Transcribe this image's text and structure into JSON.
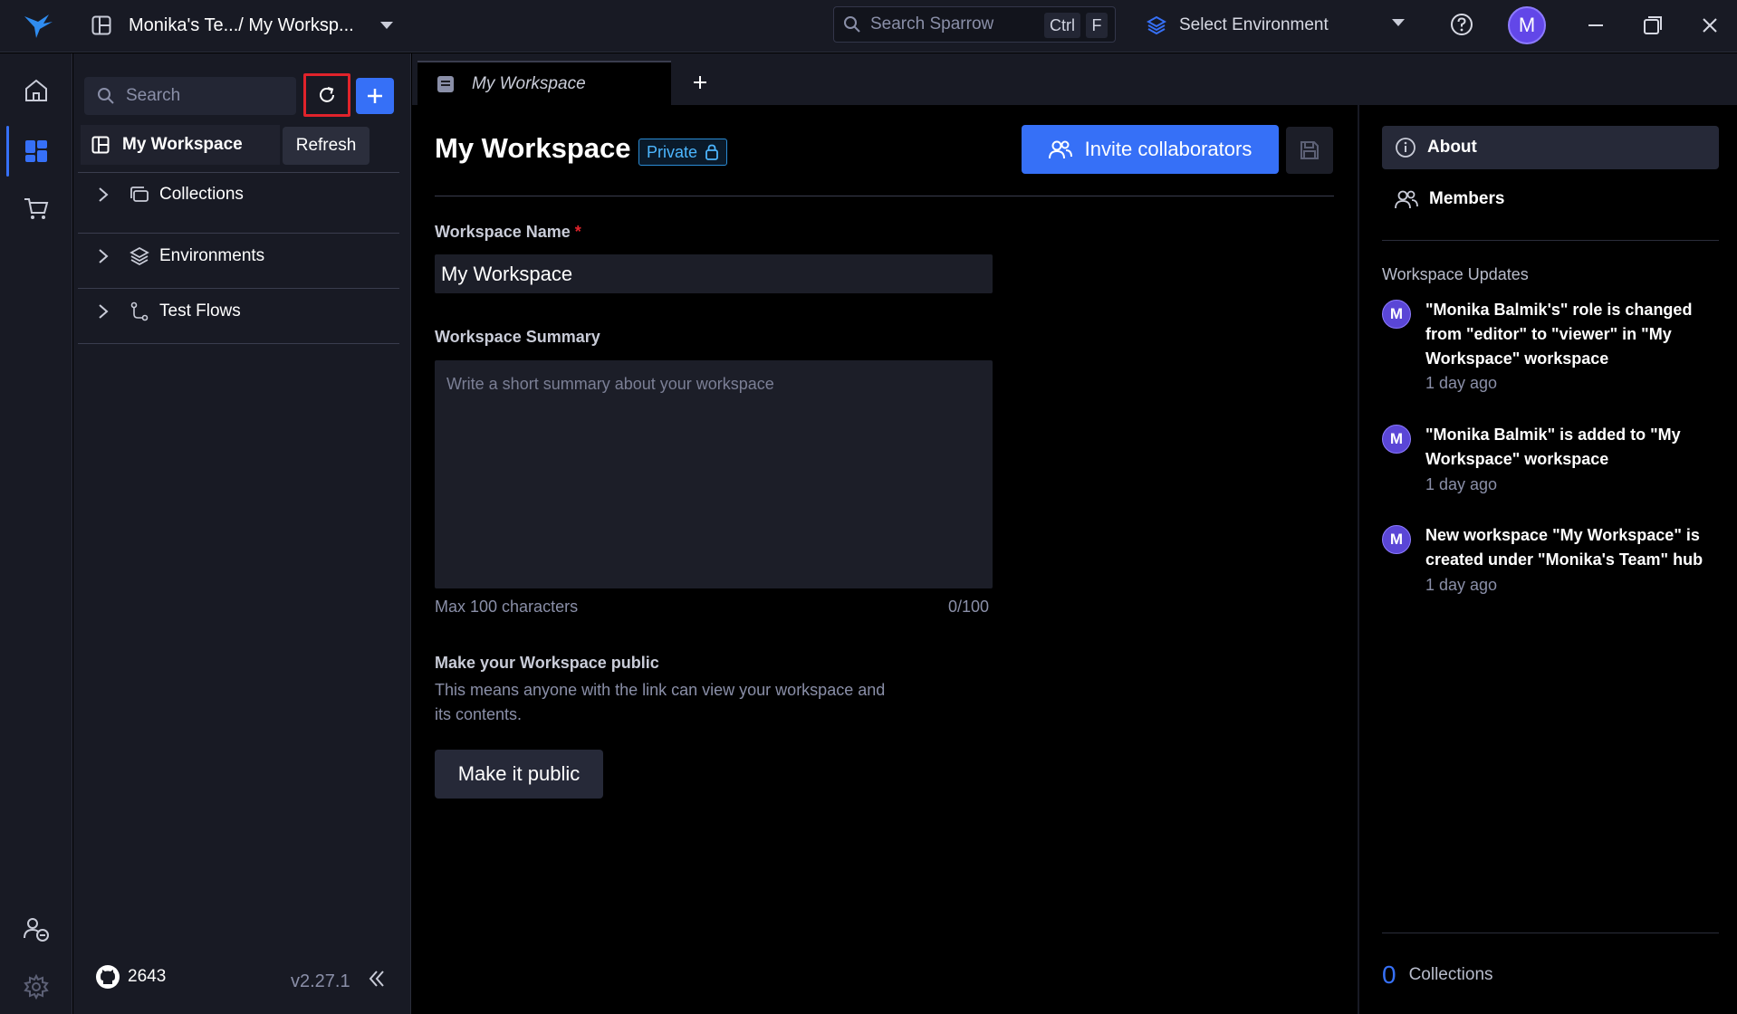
{
  "titlebar": {
    "workspace_path": "Monika's Te.../ My Worksp...",
    "search_placeholder": "Search Sparrow",
    "kbd_ctrl": "Ctrl",
    "kbd_f": "F",
    "environment_label": "Select Environment",
    "avatar_initial": "M"
  },
  "sidebar": {
    "search_placeholder": "Search",
    "tooltip": "Refresh",
    "workspace_label": "My Workspace",
    "tree": [
      {
        "label": "Collections",
        "icon": "collections-icon"
      },
      {
        "label": "Environments",
        "icon": "environments-icon"
      },
      {
        "label": "Test Flows",
        "icon": "test-flows-icon"
      }
    ],
    "github_stars": "2643",
    "version": "v2.27.1"
  },
  "tabs": {
    "active_tab": "My Workspace"
  },
  "main": {
    "title": "My Workspace",
    "badge": "Private",
    "invite_label": "Invite collaborators",
    "name_label": "Workspace Name",
    "name_required": "*",
    "name_value": "My Workspace",
    "summary_label": "Workspace Summary",
    "summary_placeholder": "Write a short summary about your workspace",
    "max_hint": "Max 100 characters",
    "char_count": "0/100",
    "public_title": "Make your Workspace public",
    "public_desc": "This means anyone with the link can view your workspace and its contents.",
    "public_button": "Make it public"
  },
  "right_panel": {
    "about_label": "About",
    "members_label": "Members",
    "updates_title": "Workspace Updates",
    "updates": [
      {
        "avatar": "M",
        "text": "\"Monika Balmik's\" role is changed from \"editor\" to \"viewer\" in \"My Workspace\" workspace",
        "time": "1 day ago"
      },
      {
        "avatar": "M",
        "text": "\"Monika Balmik\" is added to \"My Workspace\" workspace",
        "time": "1 day ago"
      },
      {
        "avatar": "M",
        "text": "New workspace \"My Workspace\" is created under \"Monika's Team\" hub",
        "time": "1 day ago"
      }
    ],
    "collections_count": "0",
    "collections_label": "Collections"
  },
  "colors": {
    "accent": "#3670f7",
    "highlight_box": "#e0232b",
    "badge": "#4cb6ff"
  }
}
